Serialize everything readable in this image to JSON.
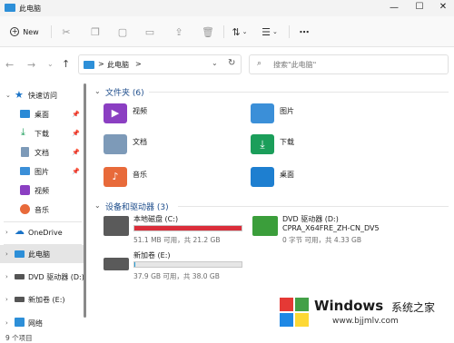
{
  "window": {
    "title": "此电脑"
  },
  "toolbar": {
    "new_label": "New"
  },
  "address": {
    "path_root_sep": ">",
    "path_item": "此电脑",
    "path_sep": ">",
    "search_placeholder": "搜索\"此电脑\""
  },
  "sidebar": {
    "quick_access": "快速访问",
    "items": [
      {
        "label": "桌面",
        "pinned": true
      },
      {
        "label": "下载",
        "pinned": true
      },
      {
        "label": "文档",
        "pinned": true
      },
      {
        "label": "图片",
        "pinned": true
      },
      {
        "label": "视频",
        "pinned": false
      },
      {
        "label": "音乐",
        "pinned": false
      }
    ],
    "onedrive": "OneDrive",
    "thispc": "此电脑",
    "dvd": "DVD 驱动器 (D:)",
    "newvol": "新加卷 (E:)",
    "network": "网络"
  },
  "folders": {
    "header": "文件夹 (6)",
    "items": [
      "视频",
      "图片",
      "文档",
      "下载",
      "音乐",
      "桌面"
    ]
  },
  "drives": {
    "header": "设备和驱动器 (3)",
    "c": {
      "name": "本地磁盘 (C:)",
      "free": "51.1 MB 可用，共 21.2 GB",
      "used_fraction": 0.998
    },
    "d": {
      "name": "DVD 驱动器 (D:)",
      "label": "CPRA_X64FRE_ZH-CN_DV5",
      "free": "0 字节 可用，共 4.33 GB"
    },
    "e": {
      "name": "新加卷 (E:)",
      "free": "37.9 GB 可用，共 38.0 GB",
      "used_fraction": 0.003
    }
  },
  "status": {
    "count": "9 个项目"
  },
  "watermark": {
    "brand": "Windows",
    "suffix": "系统之家",
    "url": "www.bjjmlv.com"
  },
  "colors": {
    "accent": "#0067c0",
    "drive_full": "#da2d3a",
    "drive_normal": "#26a0da"
  }
}
